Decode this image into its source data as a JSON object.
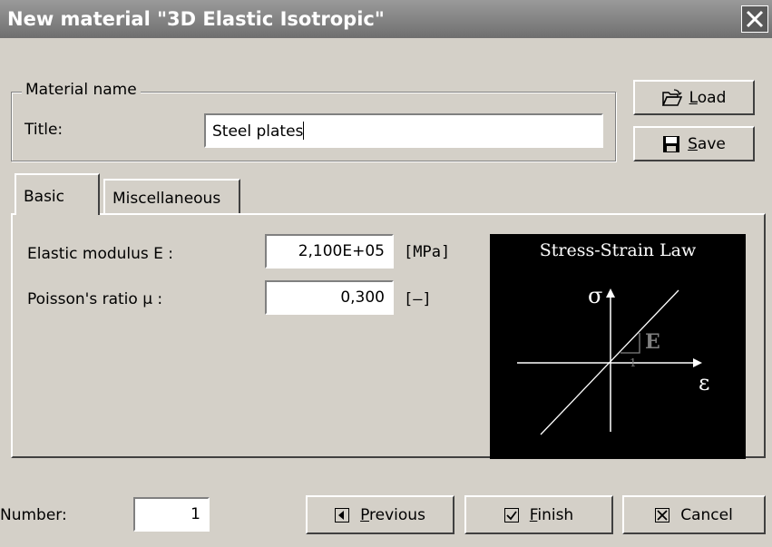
{
  "window": {
    "title": "New material \"3D Elastic Isotropic\""
  },
  "material_name": {
    "group_label": "Material name",
    "title_label": "Title:",
    "title_value": "Steel plates"
  },
  "side_buttons": {
    "load": {
      "underline": "L",
      "rest": "oad",
      "icon": "folder-open-icon"
    },
    "save": {
      "underline": "S",
      "rest": "ave",
      "icon": "floppy-disk-icon"
    }
  },
  "tabs": [
    {
      "label": "Basic",
      "active": true
    },
    {
      "label": "Miscellaneous",
      "active": false
    }
  ],
  "basic": {
    "elastic_label": "Elastic modulus E :",
    "elastic_value": "2,100E+05",
    "elastic_unit": "[MPa]",
    "poisson_label": "Poisson's ratio µ :",
    "poisson_value": "0,300",
    "poisson_unit": "[–]"
  },
  "diagram": {
    "title": "Stress-Strain Law",
    "sigma": "σ",
    "epsilon": "ε",
    "slope_label": "E",
    "unit_label": "1"
  },
  "footer": {
    "number_label": "Number:",
    "number_value": "1",
    "previous": {
      "underline": "P",
      "rest": "revious",
      "icon": "arrow-left-icon"
    },
    "finish": {
      "underline": "F",
      "rest": "inish",
      "icon": "checkbox-check-icon"
    },
    "cancel": {
      "label": "Cancel",
      "icon": "close-box-icon"
    }
  },
  "colors": {
    "titlebar": "#7f7f7f",
    "face": "#d4d0c8",
    "diagram_bg": "#000000"
  }
}
